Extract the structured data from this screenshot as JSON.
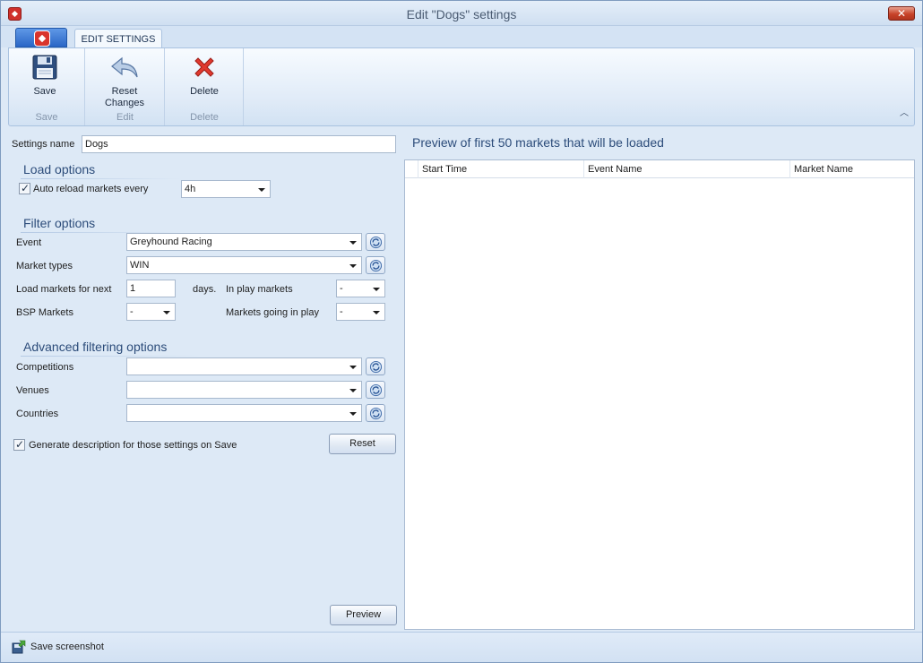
{
  "window": {
    "title": "Edit \"Dogs\" settings",
    "close_glyph": "✕"
  },
  "ribbon": {
    "active_tab": "EDIT SETTINGS",
    "buttons": {
      "save": "Save",
      "reset_line1": "Reset",
      "reset_line2": "Changes",
      "delete": "Delete"
    },
    "groups": {
      "save": "Save",
      "edit": "Edit",
      "delete": "Delete"
    },
    "collapse_glyph": "︿"
  },
  "form": {
    "settings_name_label": "Settings name",
    "settings_name_value": "Dogs",
    "load_options": {
      "title": "Load options",
      "auto_reload_label": "Auto reload markets every",
      "auto_reload_checked": true,
      "auto_reload_value": "4h"
    },
    "filter_options": {
      "title": "Filter options",
      "event_label": "Event",
      "event_value": "Greyhound Racing",
      "market_types_label": "Market types",
      "market_types_value": "WIN",
      "load_next_label": "Load markets for next",
      "load_next_value": "1",
      "days_label": "days.",
      "in_play_label": "In play markets",
      "in_play_value": "-",
      "bsp_label": "BSP Markets",
      "bsp_value": "-",
      "going_in_play_label": "Markets going in play",
      "going_in_play_value": "-"
    },
    "advanced": {
      "title": "Advanced filtering options",
      "competitions_label": "Competitions",
      "competitions_value": "",
      "venues_label": "Venues",
      "venues_value": "",
      "countries_label": "Countries",
      "countries_value": ""
    },
    "generate_desc_label": "Generate description for those settings on Save",
    "generate_desc_checked": true,
    "reset_button": "Reset",
    "preview_button": "Preview"
  },
  "preview": {
    "title": "Preview of first 50 markets that will be loaded",
    "columns": [
      "Start Time",
      "Event Name",
      "Market Name"
    ],
    "rows": []
  },
  "statusbar": {
    "save_screenshot": "Save screenshot"
  },
  "colors": {
    "accent": "#2c4c7a",
    "window_bg": "#dde9f6",
    "close_red": "#c8432a"
  }
}
